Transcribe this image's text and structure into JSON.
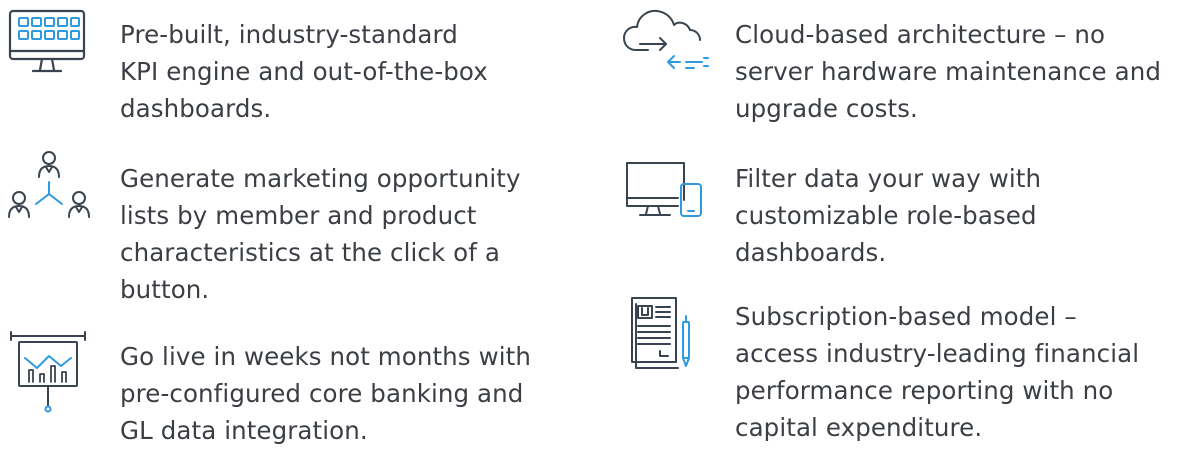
{
  "colors": {
    "icon_stroke": "#3a4450",
    "icon_accent": "#2f9ae0",
    "text": "#3b3f45",
    "background": "#ffffff"
  },
  "features": {
    "left": [
      {
        "icon": "monitor-dashboard-icon",
        "text": "Pre-built, industry-standard\nKPI engine and out-of-the-box\ndashboards."
      },
      {
        "icon": "people-network-icon",
        "text": "Generate marketing opportunity\nlists by member and product\ncharacteristics at the click of a\nbutton."
      },
      {
        "icon": "presentation-chart-icon",
        "text": "Go live in weeks not months with\npre-configured core banking and\nGL data integration."
      }
    ],
    "right": [
      {
        "icon": "cloud-transfer-icon",
        "text": "Cloud-based architecture – no\nserver hardware maintenance and\nupgrade costs."
      },
      {
        "icon": "monitor-phone-icon",
        "text": "Filter data your way with\ncustomizable role-based\ndashboards."
      },
      {
        "icon": "document-pen-icon",
        "text": "Subscription-based model –\naccess industry-leading financial\nperformance reporting with no\ncapital expenditure."
      }
    ]
  }
}
